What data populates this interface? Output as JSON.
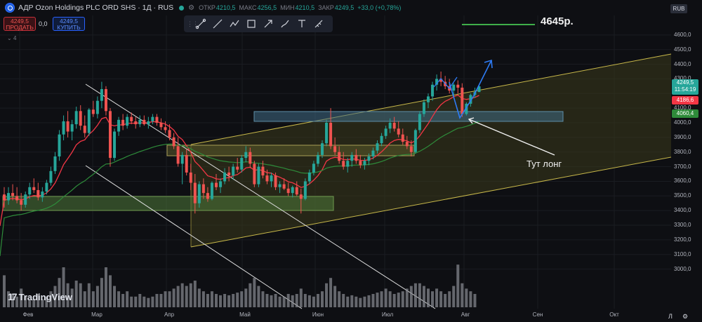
{
  "header": {
    "symbol": "АДР Ozon Holdings PLC ORD SHS · 1Д · RUS",
    "open_label": "ОТКР",
    "open": "4210,5",
    "high_label": "МАКС",
    "high": "4256,5",
    "low_label": "МИН",
    "low": "4210,5",
    "close_label": "ЗАКР",
    "close": "4249,5",
    "change": "+33,0 (+0,78%)",
    "settings_icon": "settings-icon"
  },
  "trade": {
    "sell_price": "4249,5",
    "sell_label": "ПРОДАТЬ",
    "spread": "0,0",
    "buy_price": "4249,5",
    "buy_label": "КУПИТЬ"
  },
  "indicators_count": "4",
  "currency": "RUB",
  "toolbar": [
    "trend-line-icon",
    "ray-icon",
    "path-icon",
    "rectangle-icon",
    "arrow-icon",
    "brush-icon",
    "text-icon",
    "ruler-icon"
  ],
  "price_scale": {
    "labels": [
      "4600,0",
      "4500,0",
      "4400,0",
      "4300,0",
      "4100,0",
      "4000,0",
      "3900,0",
      "3800,0",
      "3700,0",
      "3600,0",
      "3500,0",
      "3400,0",
      "3300,0",
      "3200,0",
      "3100,0",
      "3000,0"
    ],
    "last_price": "4249,5",
    "countdown": "11:54:19",
    "red_line": "4186,6",
    "green_line": "4060,4"
  },
  "time_axis": {
    "labels": [
      "Фев",
      "Мар",
      "Апр",
      "Май",
      "Июн",
      "Июл",
      "Авг",
      "Сен",
      "Окт"
    ],
    "log_button": "Л",
    "settings_icon": "gear-icon"
  },
  "annotations": {
    "target": "4645р.",
    "note": "Тут лонг"
  },
  "brand": "TradingView",
  "colors": {
    "up": "#26a69a",
    "down": "#ef5350",
    "ema_fast": "#f23645",
    "ema_slow": "#2e8b3a",
    "channel": "#c8b84a",
    "zone_blue": "#5e8fa8",
    "zone_green": "#4e7a3a",
    "arrow_blue": "#2e7cf6",
    "target_line": "#3fae4a"
  },
  "chart_data": {
    "type": "candlestick",
    "x_label": "",
    "y_label": "",
    "y_range": [
      2950,
      4650
    ],
    "x_months": [
      "Фев",
      "Мар",
      "Апр",
      "Май",
      "Июн",
      "Июл",
      "Авг",
      "Сен",
      "Окт"
    ],
    "ohlc": [
      [
        3510,
        3560,
        3420,
        3470
      ],
      [
        3470,
        3560,
        3440,
        3520
      ],
      [
        3520,
        3580,
        3470,
        3500
      ],
      [
        3500,
        3560,
        3450,
        3470
      ],
      [
        3470,
        3520,
        3400,
        3440
      ],
      [
        3440,
        3530,
        3420,
        3510
      ],
      [
        3510,
        3590,
        3480,
        3560
      ],
      [
        3560,
        3620,
        3520,
        3540
      ],
      [
        3540,
        3590,
        3470,
        3490
      ],
      [
        3490,
        3560,
        3460,
        3530
      ],
      [
        3530,
        3610,
        3510,
        3590
      ],
      [
        3590,
        3700,
        3570,
        3670
      ],
      [
        3670,
        3800,
        3650,
        3770
      ],
      [
        3770,
        3950,
        3740,
        3920
      ],
      [
        3920,
        4050,
        3880,
        4010
      ],
      [
        4010,
        4080,
        3900,
        3940
      ],
      [
        3940,
        4020,
        3880,
        3990
      ],
      [
        3990,
        4110,
        3960,
        4080
      ],
      [
        4080,
        4120,
        3950,
        3980
      ],
      [
        3980,
        4050,
        3900,
        3930
      ],
      [
        3930,
        4100,
        3910,
        4090
      ],
      [
        4090,
        4150,
        4040,
        4060
      ],
      [
        4060,
        4180,
        4030,
        4150
      ],
      [
        4150,
        4280,
        4100,
        4230
      ],
      [
        4230,
        4250,
        4050,
        4080
      ],
      [
        4080,
        4100,
        3700,
        3760
      ],
      [
        3760,
        3960,
        3740,
        3940
      ],
      [
        3940,
        4040,
        3910,
        4020
      ],
      [
        4020,
        4060,
        3950,
        3980
      ],
      [
        3980,
        4060,
        3960,
        4040
      ],
      [
        4040,
        4070,
        3990,
        4010
      ],
      [
        4010,
        4040,
        3960,
        3990
      ],
      [
        3990,
        4050,
        3970,
        4020
      ],
      [
        4020,
        4050,
        3980,
        3990
      ],
      [
        3990,
        4040,
        3960,
        4010
      ],
      [
        4010,
        4060,
        3990,
        4040
      ],
      [
        4040,
        4060,
        3980,
        4000
      ],
      [
        4000,
        4030,
        3950,
        3970
      ],
      [
        3970,
        4010,
        3930,
        3950
      ],
      [
        3950,
        3990,
        3880,
        3900
      ],
      [
        3900,
        3930,
        3820,
        3840
      ],
      [
        3840,
        3900,
        3700,
        3720
      ],
      [
        3720,
        3800,
        3580,
        3780
      ],
      [
        3780,
        3820,
        3640,
        3660
      ],
      [
        3660,
        3720,
        3540,
        3590
      ],
      [
        3590,
        3650,
        3380,
        3450
      ],
      [
        3450,
        3600,
        3420,
        3580
      ],
      [
        3580,
        3620,
        3480,
        3520
      ],
      [
        3520,
        3560,
        3460,
        3480
      ],
      [
        3480,
        3600,
        3470,
        3590
      ],
      [
        3590,
        3650,
        3540,
        3560
      ],
      [
        3560,
        3620,
        3520,
        3600
      ],
      [
        3600,
        3690,
        3580,
        3660
      ],
      [
        3660,
        3700,
        3600,
        3640
      ],
      [
        3640,
        3720,
        3610,
        3700
      ],
      [
        3700,
        3760,
        3660,
        3680
      ],
      [
        3680,
        3780,
        3660,
        3760
      ],
      [
        3760,
        3840,
        3730,
        3800
      ],
      [
        3800,
        3830,
        3690,
        3720
      ],
      [
        3720,
        3740,
        3560,
        3580
      ],
      [
        3580,
        3720,
        3560,
        3700
      ],
      [
        3700,
        3740,
        3620,
        3640
      ],
      [
        3640,
        3680,
        3580,
        3600
      ],
      [
        3600,
        3660,
        3560,
        3640
      ],
      [
        3640,
        3660,
        3540,
        3560
      ],
      [
        3560,
        3600,
        3520,
        3580
      ],
      [
        3580,
        3620,
        3540,
        3550
      ],
      [
        3550,
        3590,
        3500,
        3520
      ],
      [
        3520,
        3570,
        3490,
        3560
      ],
      [
        3560,
        3600,
        3500,
        3510
      ],
      [
        3510,
        3550,
        3380,
        3480
      ],
      [
        3480,
        3620,
        3470,
        3600
      ],
      [
        3600,
        3680,
        3580,
        3660
      ],
      [
        3660,
        3740,
        3640,
        3720
      ],
      [
        3720,
        3800,
        3700,
        3780
      ],
      [
        3780,
        3880,
        3760,
        3860
      ],
      [
        3860,
        4020,
        3840,
        4000
      ],
      [
        4000,
        4100,
        3820,
        3840
      ],
      [
        3840,
        3900,
        3780,
        3800
      ],
      [
        3800,
        3840,
        3720,
        3740
      ],
      [
        3740,
        3800,
        3680,
        3700
      ],
      [
        3700,
        3760,
        3660,
        3740
      ],
      [
        3740,
        3800,
        3700,
        3780
      ],
      [
        3780,
        3820,
        3720,
        3740
      ],
      [
        3740,
        3780,
        3690,
        3710
      ],
      [
        3710,
        3760,
        3680,
        3740
      ],
      [
        3740,
        3790,
        3710,
        3770
      ],
      [
        3770,
        3830,
        3750,
        3810
      ],
      [
        3810,
        3880,
        3790,
        3860
      ],
      [
        3860,
        3930,
        3840,
        3910
      ],
      [
        3910,
        3980,
        3890,
        3960
      ],
      [
        3960,
        4030,
        3930,
        4000
      ],
      [
        4000,
        4040,
        3940,
        3960
      ],
      [
        3960,
        4010,
        3900,
        3920
      ],
      [
        3920,
        3960,
        3850,
        3870
      ],
      [
        3870,
        3910,
        3820,
        3840
      ],
      [
        3840,
        3880,
        3770,
        3800
      ],
      [
        3800,
        3960,
        3790,
        3950
      ],
      [
        3950,
        4080,
        3930,
        4060
      ],
      [
        4060,
        4160,
        4040,
        4140
      ],
      [
        4140,
        4200,
        4100,
        4180
      ],
      [
        4180,
        4280,
        4150,
        4260
      ],
      [
        4260,
        4330,
        4220,
        4300
      ],
      [
        4300,
        4350,
        4250,
        4280
      ],
      [
        4280,
        4320,
        4230,
        4250
      ],
      [
        4250,
        4300,
        4200,
        4220
      ],
      [
        4220,
        4270,
        4180,
        4260
      ],
      [
        4260,
        4290,
        4200,
        4240
      ],
      [
        4240,
        4270,
        4040,
        4060
      ],
      [
        4060,
        4140,
        4050,
        4130
      ],
      [
        4130,
        4200,
        4110,
        4190
      ],
      [
        4190,
        4240,
        4170,
        4210
      ],
      [
        4210,
        4256,
        4210,
        4249
      ]
    ],
    "volume": [
      120,
      60,
      50,
      40,
      70,
      40,
      30,
      30,
      50,
      30,
      40,
      60,
      80,
      110,
      150,
      90,
      70,
      100,
      90,
      60,
      90,
      60,
      80,
      110,
      150,
      120,
      80,
      60,
      50,
      60,
      40,
      40,
      50,
      40,
      35,
      40,
      50,
      50,
      60,
      60,
      70,
      80,
      90,
      80,
      90,
      100,
      70,
      60,
      50,
      60,
      50,
      45,
      50,
      45,
      50,
      55,
      60,
      70,
      90,
      110,
      80,
      60,
      50,
      45,
      50,
      40,
      40,
      50,
      45,
      50,
      70,
      50,
      45,
      40,
      50,
      60,
      90,
      110,
      80,
      60,
      50,
      40,
      45,
      40,
      35,
      40,
      45,
      50,
      55,
      60,
      70,
      60,
      50,
      55,
      60,
      70,
      80,
      90,
      90,
      80,
      70,
      60,
      70,
      60,
      50,
      60,
      80,
      160,
      90,
      70,
      60,
      50
    ],
    "ema_fast_hint": "red moving average",
    "ema_slow_hint": "green moving average"
  }
}
